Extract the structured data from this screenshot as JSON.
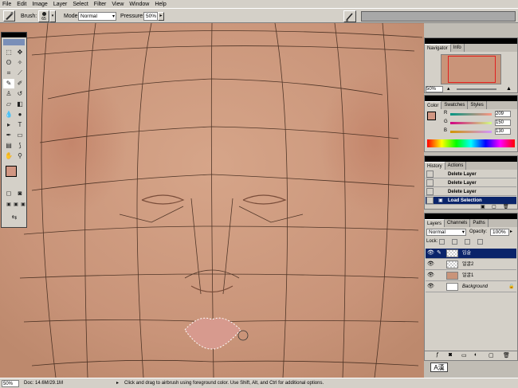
{
  "menu": [
    "File",
    "Edit",
    "Image",
    "Layer",
    "Select",
    "Filter",
    "View",
    "Window",
    "Help"
  ],
  "options": {
    "brush_label": "Brush:",
    "brush_size": "65",
    "mode_label": "Mode:",
    "mode_value": "Normal",
    "pressure_label": "Pressure:",
    "pressure_value": "50%"
  },
  "navigator": {
    "tabs": [
      "Navigator",
      "Info"
    ],
    "zoom": "50%"
  },
  "color": {
    "tabs": [
      "Color",
      "Swatches",
      "Styles"
    ],
    "r_label": "R",
    "r_value": "209",
    "g_label": "G",
    "g_value": "150",
    "b_label": "B",
    "b_value": "130",
    "foreground_color": "#d19682",
    "channels": {
      "r": 209,
      "g": 150,
      "b": 130
    }
  },
  "history": {
    "tabs": [
      "History",
      "Actions"
    ],
    "items": [
      {
        "label": "Delete Layer"
      },
      {
        "label": "Delete Layer"
      },
      {
        "label": "Delete Layer"
      },
      {
        "label": "Load Selection"
      }
    ]
  },
  "layers": {
    "tabs": [
      "Layers",
      "Channels",
      "Paths"
    ],
    "blend_mode": "Normal",
    "opacity_label": "Opacity:",
    "opacity_value": "100%",
    "lock_label": "Lock:",
    "items": [
      {
        "name": "입술"
      },
      {
        "name": "얼굴2"
      },
      {
        "name": "얼굴1"
      },
      {
        "name": "Background"
      }
    ]
  },
  "ime": {
    "label": "A漢"
  },
  "status": {
    "zoom": "50%",
    "doc": "Doc: 14.6M/29.1M",
    "hint": "Click and drag to airbrush using foreground color.  Use Shift, Alt, and Ctrl for additional options."
  }
}
